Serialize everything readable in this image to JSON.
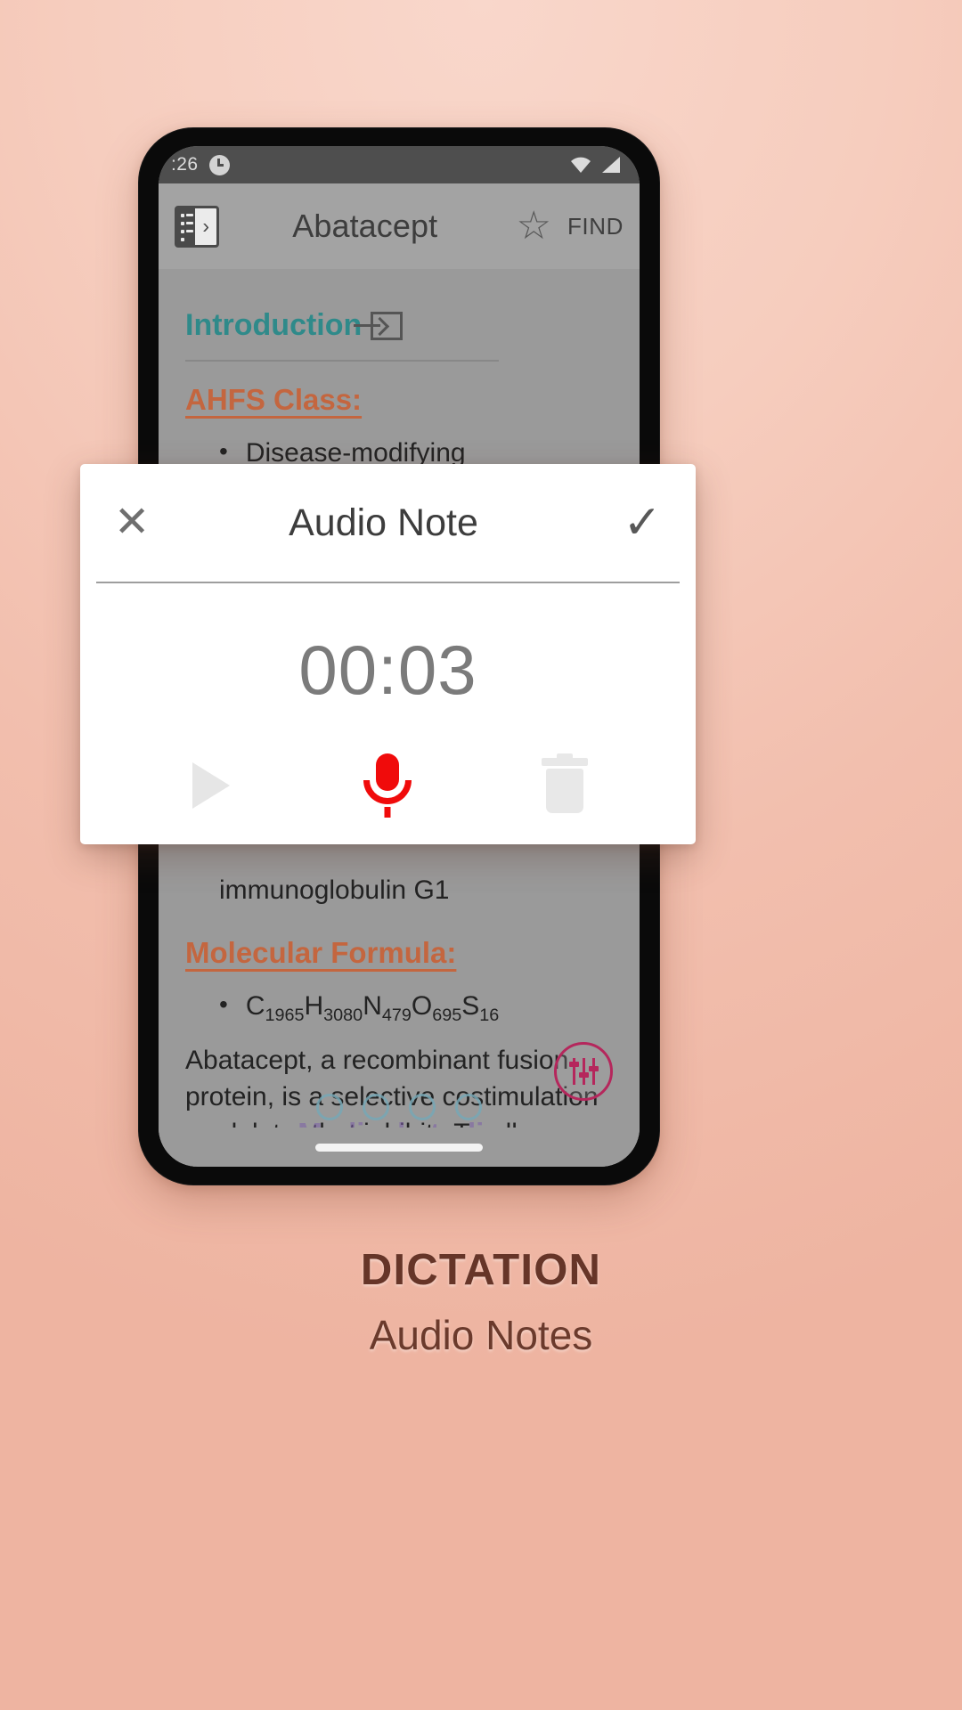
{
  "status_bar": {
    "time": ":26",
    "alarm_icon": "alarm-clock-icon",
    "wifi_icon": "wifi-icon",
    "signal_icon": "cell-signal-icon"
  },
  "app_bar": {
    "menu_icon": "index-panel-icon",
    "title": "Abatacept",
    "star_icon": "★",
    "star_glyph": "☆",
    "find_label": "FIND"
  },
  "document": {
    "section_heading": "Introduction",
    "section_external_icon": "open-in-new-icon",
    "sub_heading_1": "AHFS Class:",
    "bullet_1": "Disease-modifying Antirheumati",
    "bullet_2": "immunoglobulin G1",
    "sub_heading_2": "Molecular Formula:",
    "formula_parts": [
      "C",
      "1965",
      "H",
      "3080",
      "N",
      "479",
      "O",
      "695",
      "S",
      "16"
    ],
    "paragraph": "Abatacept, a recombinant fusion protein, is a selective costimulation modulator that inhibits T-cell activation and is a biologic disease-modifying antirheumatic drug",
    "ghost_tab": "Medical studie",
    "bullet_glyph": "•"
  },
  "fab": {
    "name": "settings-sliders-fab",
    "color": "#b5275c"
  },
  "dialog": {
    "close_label": "✕",
    "title": "Audio Note",
    "confirm_label": "✓",
    "timer": "00:03",
    "controls": {
      "play": "play-icon",
      "record": "microphone-icon",
      "delete": "trash-icon"
    },
    "record_color": "#f00b0b"
  },
  "caption": {
    "title": "DICTATION",
    "subtitle": "Audio Notes"
  }
}
